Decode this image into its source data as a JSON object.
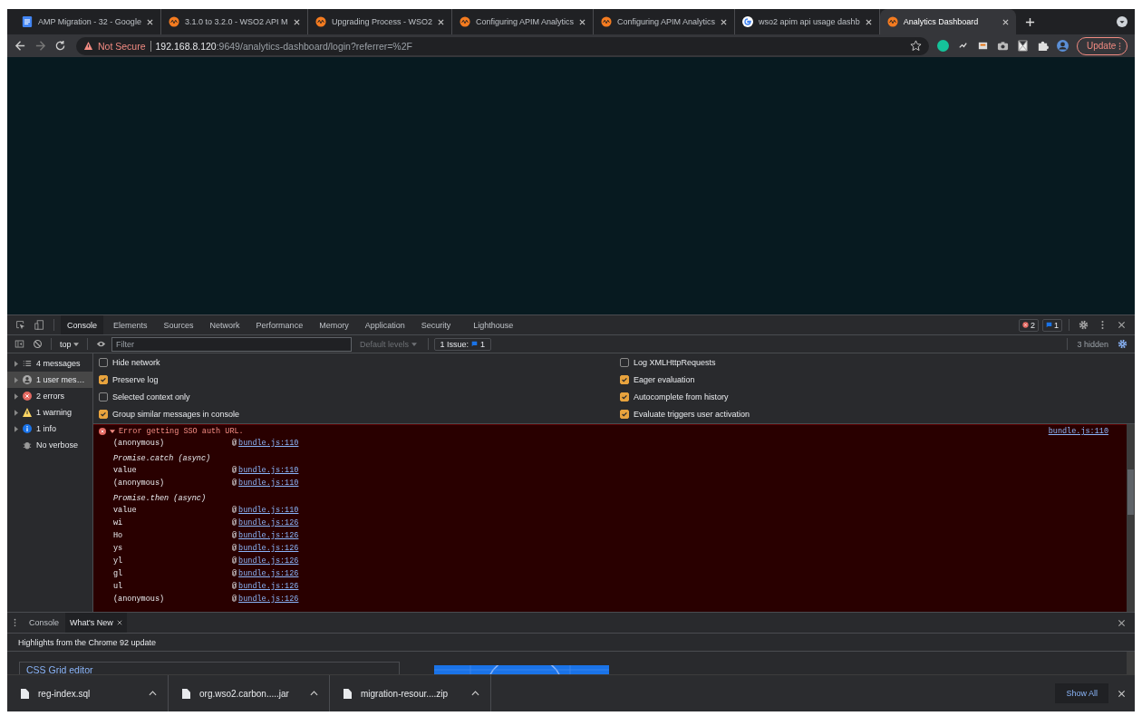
{
  "browser": {
    "tabs": [
      {
        "title": "AMP Migration - 32 - Google",
        "kind": "doc",
        "selected": false
      },
      {
        "title": "3.1.0 to 3.2.0 - WSO2 API M",
        "kind": "wso2",
        "selected": false
      },
      {
        "title": "Upgrading Process - WSO2",
        "kind": "wso2",
        "selected": false
      },
      {
        "title": "Configuring APIM Analytics",
        "kind": "wso2",
        "selected": false
      },
      {
        "title": "Configuring APIM Analytics",
        "kind": "wso2",
        "selected": false
      },
      {
        "title": "wso2 apim api usage dashb",
        "kind": "google",
        "selected": false
      },
      {
        "title": "Analytics Dashboard",
        "kind": "wso2",
        "selected": true
      }
    ],
    "security": "Not Secure",
    "url_host": "192.168.8.120",
    "url_rest": ":9649/analytics-dashboard/login?referrer=%2F",
    "update_button": "Update"
  },
  "devtools": {
    "tabs": [
      {
        "label": "Console",
        "selected": true
      },
      {
        "label": "Elements",
        "selected": false
      },
      {
        "label": "Sources",
        "selected": false
      },
      {
        "label": "Network",
        "selected": false
      },
      {
        "label": "Performance",
        "selected": false
      },
      {
        "label": "Memory",
        "selected": false
      },
      {
        "label": "Application",
        "selected": false
      },
      {
        "label": "Security",
        "selected": false
      },
      {
        "label": "Lighthouse",
        "selected": false
      }
    ],
    "error_count": "2",
    "issue_count": "1",
    "toolbar": {
      "context": "top",
      "filter_placeholder": "Filter",
      "levels": "Default levels",
      "issues_label": "1 Issue:",
      "issues_count": "1",
      "hidden": "3 hidden"
    },
    "sidebar": [
      {
        "label": "4 messages",
        "kind": "list",
        "selected": false
      },
      {
        "label": "1 user mes…",
        "kind": "user",
        "selected": true
      },
      {
        "label": "2 errors",
        "kind": "error",
        "selected": false
      },
      {
        "label": "1 warning",
        "kind": "warning",
        "selected": false
      },
      {
        "label": "1 info",
        "kind": "info",
        "selected": false
      },
      {
        "label": "No verbose",
        "kind": "verbose",
        "selected": false
      }
    ],
    "settings_left": [
      {
        "label": "Hide network",
        "checked": false
      },
      {
        "label": "Preserve log",
        "checked": true
      },
      {
        "label": "Selected context only",
        "checked": false
      },
      {
        "label": "Group similar messages in console",
        "checked": true
      }
    ],
    "settings_right": [
      {
        "label": "Log XMLHttpRequests",
        "checked": false
      },
      {
        "label": "Eager evaluation",
        "checked": true
      },
      {
        "label": "Autocomplete from history",
        "checked": true
      },
      {
        "label": "Evaluate triggers user activation",
        "checked": true
      }
    ],
    "error": {
      "message": "Error getting SSO auth URL.",
      "source": "bundle.js:110",
      "stack": [
        {
          "kind": "frame",
          "fn": "(anonymous)",
          "at": "@",
          "link": "bundle.js:110"
        },
        {
          "kind": "async",
          "fn": "Promise.catch (async)"
        },
        {
          "kind": "frame",
          "fn": "value",
          "at": "@",
          "link": "bundle.js:110"
        },
        {
          "kind": "frame",
          "fn": "(anonymous)",
          "at": "@",
          "link": "bundle.js:110"
        },
        {
          "kind": "async",
          "fn": "Promise.then (async)"
        },
        {
          "kind": "frame",
          "fn": "value",
          "at": "@",
          "link": "bundle.js:110"
        },
        {
          "kind": "frame",
          "fn": "wi",
          "at": "@",
          "link": "bundle.js:126"
        },
        {
          "kind": "frame",
          "fn": "Ho",
          "at": "@",
          "link": "bundle.js:126"
        },
        {
          "kind": "frame",
          "fn": "ys",
          "at": "@",
          "link": "bundle.js:126"
        },
        {
          "kind": "frame",
          "fn": "yl",
          "at": "@",
          "link": "bundle.js:126"
        },
        {
          "kind": "frame",
          "fn": "gl",
          "at": "@",
          "link": "bundle.js:126"
        },
        {
          "kind": "frame",
          "fn": "ul",
          "at": "@",
          "link": "bundle.js:126"
        },
        {
          "kind": "frame",
          "fn": "(anonymous)",
          "at": "@",
          "link": "bundle.js:126"
        }
      ]
    },
    "drawer_tabs": [
      {
        "label": "Console",
        "selected": false,
        "closable": false
      },
      {
        "label": "What's New",
        "selected": true,
        "closable": true
      }
    ],
    "whats_new": {
      "heading": "Highlights from the Chrome 92 update",
      "card_title": "CSS Grid editor"
    }
  },
  "downloads": {
    "items": [
      {
        "name": "reg-index.sql"
      },
      {
        "name": "org.wso2.carbon.....jar"
      },
      {
        "name": "migration-resour....zip"
      }
    ],
    "show_all": "Show All"
  }
}
